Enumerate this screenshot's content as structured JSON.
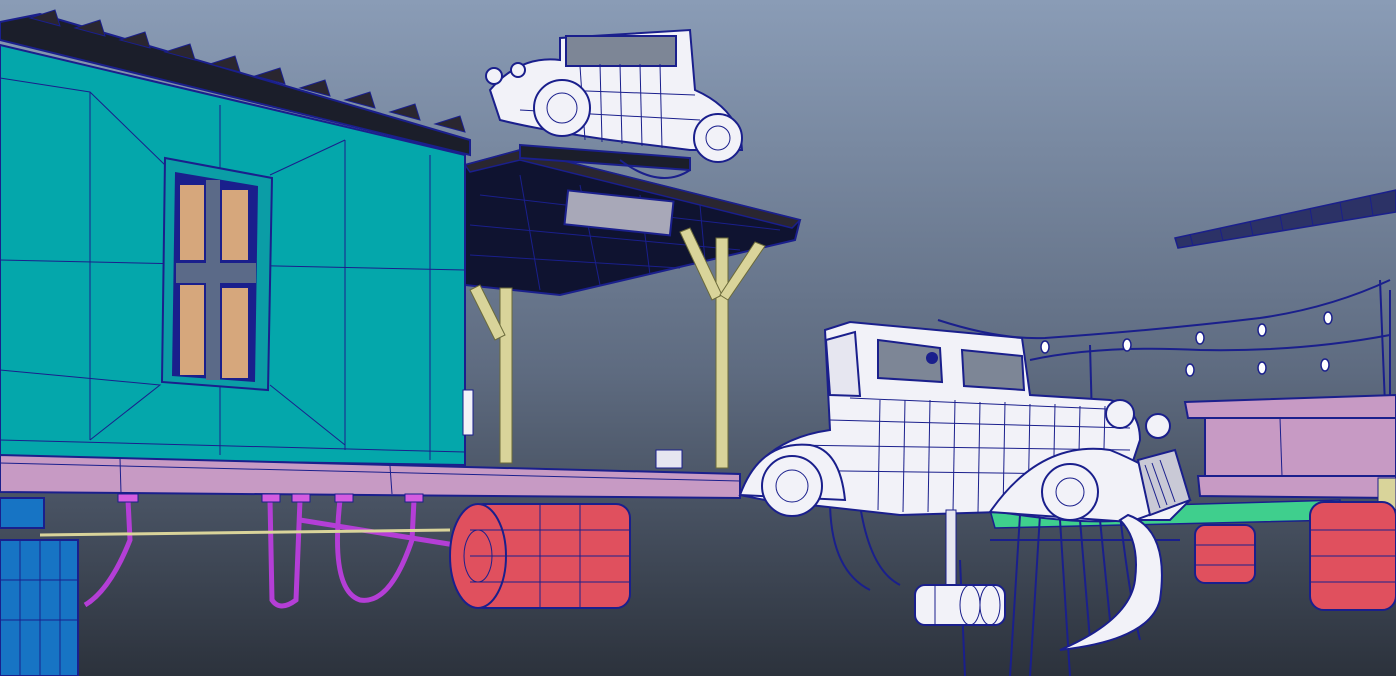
{
  "viewport": {
    "description_name": "3d-wireframe-viewport",
    "colors": {
      "sky_top": "#8a9cb6",
      "sky_bottom": "#2c323c",
      "wire": "#1a1f8c",
      "house_wall": "#04a7ab",
      "window_pane": "#d6a77c",
      "platform": "#c79ac4",
      "tank_red": "#e0505e",
      "car_body": "#f2f2f8",
      "roof": "#1b1e2a",
      "pillar": "#d9d49a",
      "pipe": "#b43ed6",
      "barrel_blue": "#1774c4",
      "green_plank": "#3fcf8d"
    }
  },
  "objects": [
    {
      "name": "house",
      "type": "mesh"
    },
    {
      "name": "awning",
      "type": "mesh"
    },
    {
      "name": "roof-car",
      "type": "mesh"
    },
    {
      "name": "main-car",
      "type": "mesh"
    },
    {
      "name": "red-tanks",
      "type": "mesh"
    },
    {
      "name": "string-lights",
      "type": "mesh"
    },
    {
      "name": "right-platform",
      "type": "mesh"
    },
    {
      "name": "blue-barrel",
      "type": "mesh"
    }
  ]
}
